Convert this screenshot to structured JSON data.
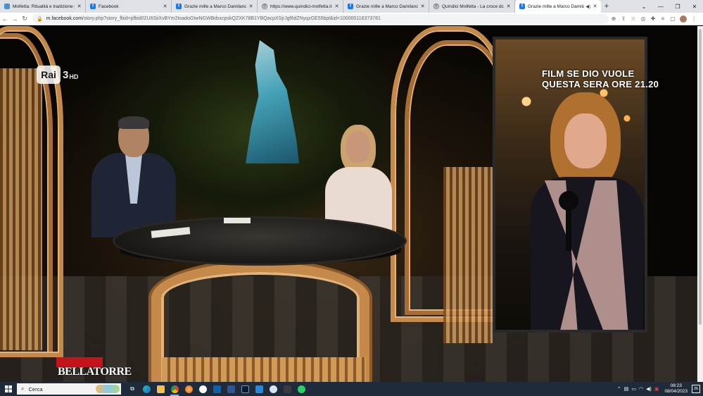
{
  "browser": {
    "tabs": [
      {
        "title": "Molfetta: Ritualità e tradizione p",
        "favicon": "molfetta-icon",
        "active": false
      },
      {
        "title": "Facebook",
        "favicon": "facebook-icon",
        "active": false
      },
      {
        "title": "Grazie mille a Marco Damilano p",
        "favicon": "facebook-icon",
        "active": false
      },
      {
        "title": "https://www.quindici-molfetta.it",
        "favicon": "globe-icon",
        "active": false
      },
      {
        "title": "Grazie mille a Marco Damilano p",
        "favicon": "facebook-icon",
        "active": false
      },
      {
        "title": "Quindici Molfetta - La croce dc",
        "favicon": "globe-icon",
        "active": false
      },
      {
        "title": "Grazie mille a Marco Damilano",
        "favicon": "facebook-icon",
        "active": true
      }
    ],
    "url_host": "m.facebook.com",
    "url_path": "/story.php?story_fbid=pfbid02U6SiiXvBYm2toadoGtwNGWBdsxcpskQZXK78B1YBQacpXSjrJgf6dZNyqzGE55bpl&id=100000116373781"
  },
  "video": {
    "channel_name": "Rai",
    "channel_number": "3",
    "channel_quality": "HD",
    "overlay_line1": "FILM SE DIO VUOLE",
    "overlay_line2": "QUESTA SERA ORE 21.20",
    "program_logo_text": "BELLATORRE"
  },
  "taskbar": {
    "search_placeholder": "Cerca",
    "time": "08:23",
    "date": "08/04/2023",
    "notification_count": "26"
  },
  "colors": {
    "facebook_blue": "#1877f2",
    "taskbar_bg": "#1f2a3a",
    "program_red": "#c2141a"
  }
}
